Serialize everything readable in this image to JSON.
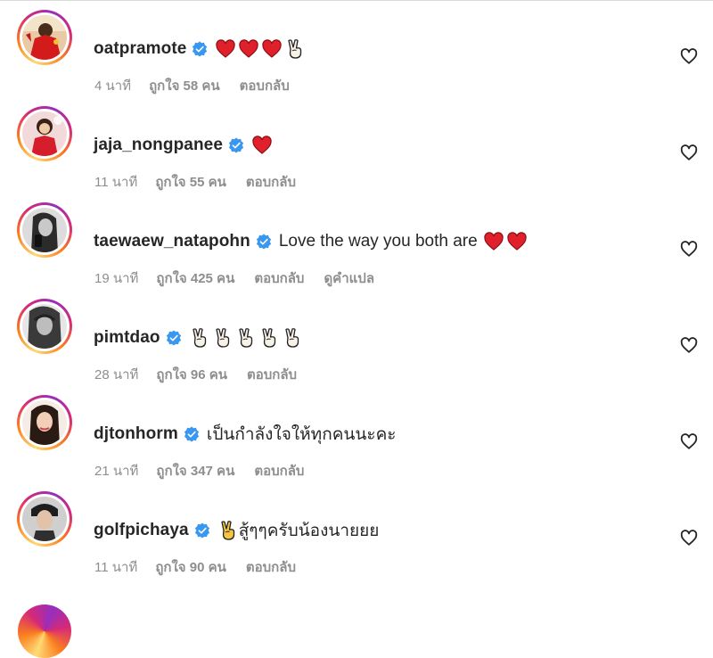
{
  "colors": {
    "verified_badge": "#3897f0",
    "heart_emoji": "#e0202a",
    "meta_text": "#8e8e8e",
    "primary_text": "#262626",
    "story_ring": [
      "#feda75",
      "#fa7e1e",
      "#d62976",
      "#962fbf"
    ]
  },
  "icons": {
    "verified": "verified-badge-icon",
    "like": "heart-outline-icon",
    "red_heart_emoji": "red-heart-emoji",
    "victory_emoji": "victory-hand-emoji"
  },
  "comments": [
    {
      "username": "oatpramote",
      "verified": true,
      "text": "",
      "emojis": [
        "red-heart",
        "red-heart",
        "red-heart",
        "victory-hand"
      ],
      "time": "4 นาที",
      "likes": "ถูกใจ 58 คน",
      "reply": "ตอบกลับ",
      "translate": ""
    },
    {
      "username": "jaja_nongpanee",
      "verified": true,
      "text": "",
      "emojis": [
        "red-heart"
      ],
      "time": "11 นาที",
      "likes": "ถูกใจ 55 คน",
      "reply": "ตอบกลับ",
      "translate": ""
    },
    {
      "username": "taewaew_natapohn",
      "verified": true,
      "text": "Love the way you both are",
      "emojis": [
        "red-heart",
        "red-heart"
      ],
      "time": "19 นาที",
      "likes": "ถูกใจ 425 คน",
      "reply": "ตอบกลับ",
      "translate": "ดูคำแปล"
    },
    {
      "username": "pimtdao",
      "verified": true,
      "text": "",
      "emojis": [
        "victory-hand",
        "victory-hand",
        "victory-hand",
        "victory-hand",
        "victory-hand"
      ],
      "time": "28 นาที",
      "likes": "ถูกใจ 96 คน",
      "reply": "ตอบกลับ",
      "translate": ""
    },
    {
      "username": "djtonhorm",
      "verified": true,
      "text": "เป็นกำลังใจให้ทุกคนนะคะ",
      "emojis": [],
      "time": "21 นาที",
      "likes": "ถูกใจ 347 คน",
      "reply": "ตอบกลับ",
      "translate": ""
    },
    {
      "username": "golfpichaya",
      "verified": true,
      "text": "สู้ๆๆครับน้องนายยย",
      "emojis_before": [
        "victory-hand"
      ],
      "emojis": [],
      "time": "11 นาที",
      "likes": "ถูกใจ 90 คน",
      "reply": "ตอบกลับ",
      "translate": ""
    }
  ]
}
